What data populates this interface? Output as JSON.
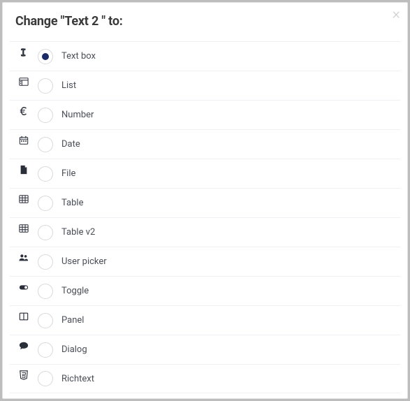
{
  "dialog": {
    "title": "Change \"Text 2 \" to:"
  },
  "options": [
    {
      "label": "Text box",
      "selected": true,
      "icon": "text-cursor-icon"
    },
    {
      "label": "List",
      "selected": false,
      "icon": "list-icon"
    },
    {
      "label": "Number",
      "selected": false,
      "icon": "euro-icon"
    },
    {
      "label": "Date",
      "selected": false,
      "icon": "calendar-icon"
    },
    {
      "label": "File",
      "selected": false,
      "icon": "file-icon"
    },
    {
      "label": "Table",
      "selected": false,
      "icon": "table-icon"
    },
    {
      "label": "Table v2",
      "selected": false,
      "icon": "table-icon"
    },
    {
      "label": "User picker",
      "selected": false,
      "icon": "users-icon"
    },
    {
      "label": "Toggle",
      "selected": false,
      "icon": "toggle-icon"
    },
    {
      "label": "Panel",
      "selected": false,
      "icon": "panel-icon"
    },
    {
      "label": "Dialog",
      "selected": false,
      "icon": "comment-icon"
    },
    {
      "label": "Richtext",
      "selected": false,
      "icon": "html-icon"
    }
  ]
}
